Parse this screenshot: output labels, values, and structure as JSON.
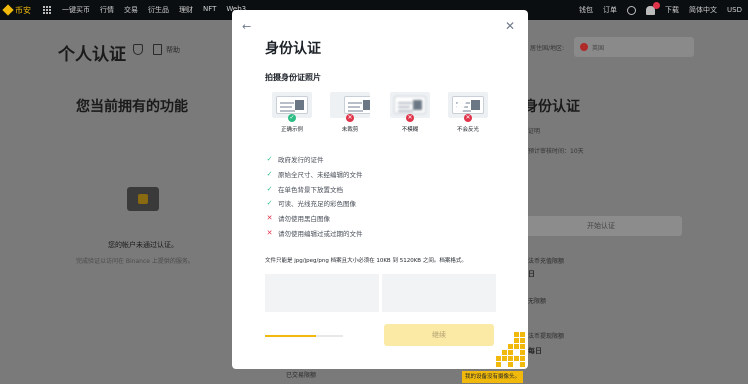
{
  "nav": {
    "logo_text": "币安",
    "items": [
      "一键买币",
      "行情",
      "交易",
      "衍生品",
      "理财",
      "NFT",
      "Web3"
    ],
    "right": [
      "钱包",
      "订单",
      "下载",
      "简体中文",
      "USD"
    ],
    "notification_count": ""
  },
  "page": {
    "title": "个人认证",
    "help": "帮助",
    "features_title": "您当前拥有的功能",
    "not_verified": "您的帐户未通过认证。",
    "not_verified_desc": "完成验证以访问在 Binance 上提供的服务。",
    "region_label": "居住国/地区:",
    "region_value": "英国",
    "right_title": "身份认证",
    "right_line1": "证明",
    "right_line2": "预计审核时间：10天",
    "right_button": "开始认证",
    "right_texts": [
      "法币充值限额",
      "日",
      "无限额",
      "法币提现限额",
      "每日"
    ],
    "bottom_link": "已交易限额"
  },
  "modal": {
    "title": "身份认证",
    "section_title": "拍摄身份证照片",
    "samples": [
      {
        "label": "正确示例",
        "status": "ok",
        "icon": "check-icon"
      },
      {
        "label": "未裁剪",
        "status": "bad",
        "icon": "cross-icon"
      },
      {
        "label": "不模糊",
        "status": "bad",
        "icon": "cross-icon"
      },
      {
        "label": "不会反光",
        "status": "bad",
        "icon": "cross-icon"
      }
    ],
    "rules": [
      {
        "text": "政府发行的证件",
        "status": "ok"
      },
      {
        "text": "原始全尺寸、未经编辑的文件",
        "status": "ok"
      },
      {
        "text": "在单色背景下放置文档",
        "status": "ok"
      },
      {
        "text": "可读、光线充足的彩色图像",
        "status": "ok"
      },
      {
        "text": "请勿使用黑白图像",
        "status": "bad"
      },
      {
        "text": "请勿使用编辑过或过期的文件",
        "status": "bad"
      }
    ],
    "format_note": "文件只能是 jpg/jpeg/png 档案且大小必须在 10KB 到 5120KB 之间。档案格式。",
    "progress": 0.66,
    "continue_label": "继续"
  },
  "qr_tip": "我的设备没有摄像头。",
  "colors": {
    "brand": "#f0b90b",
    "ok": "#2ebd85",
    "bad": "#e0344b",
    "button_disabled": "#fbe9a6"
  }
}
